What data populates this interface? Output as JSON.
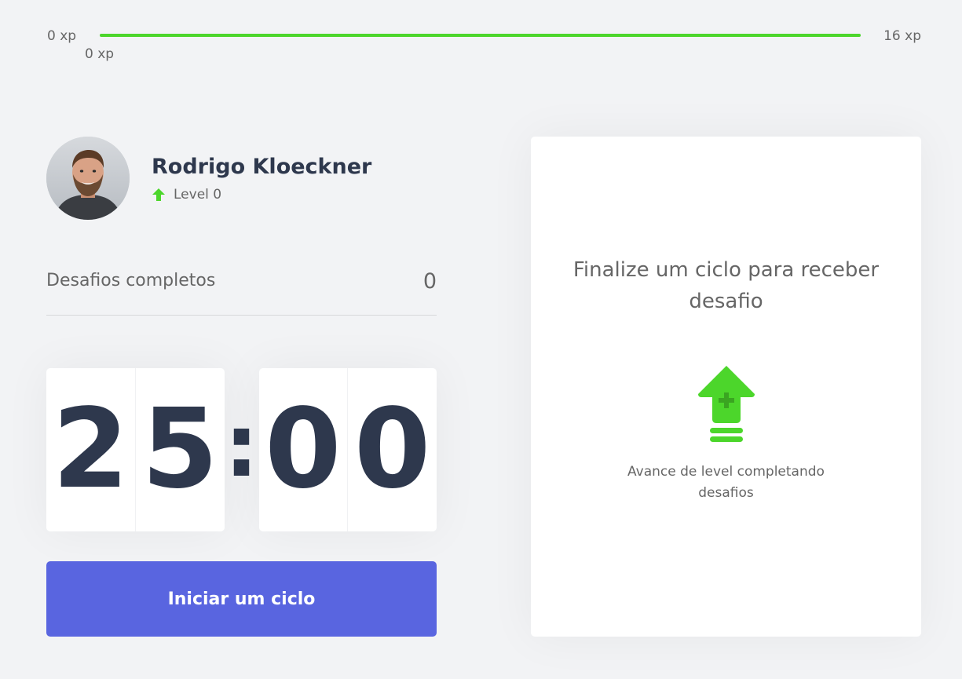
{
  "xp": {
    "min_label": "0 xp",
    "max_label": "16 xp",
    "current_label": "0 xp",
    "progress_percent": 100,
    "color": "#4cd62b"
  },
  "profile": {
    "name": "Rodrigo Kloeckner",
    "level_label": "Level 0",
    "level_icon": "level-up-arrow-icon"
  },
  "completed": {
    "label": "Desafios completos",
    "count": "0"
  },
  "countdown": {
    "minute_left": "2",
    "minute_right": "5",
    "separator": ":",
    "second_left": "0",
    "second_right": "0"
  },
  "start_button": {
    "label": "Iniciar um ciclo",
    "color": "#5965e0"
  },
  "challenge": {
    "title": "Finalize um ciclo para receber desafio",
    "hint": "Avance de level completando desafios",
    "icon": "level-up-icon"
  }
}
